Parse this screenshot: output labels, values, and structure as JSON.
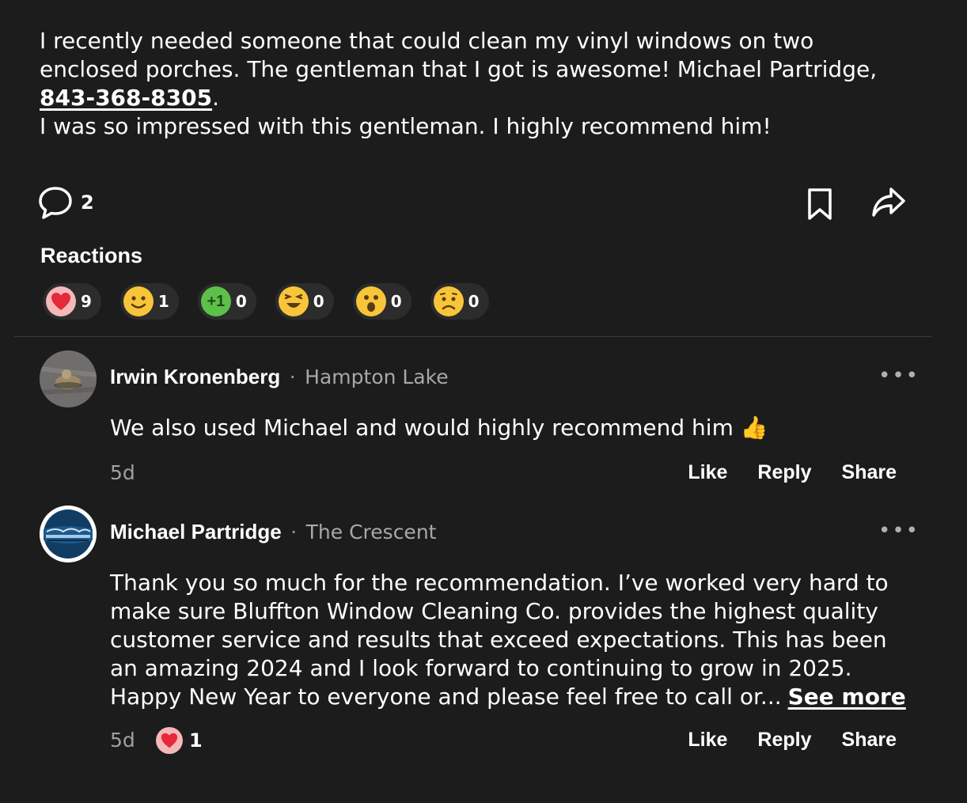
{
  "post": {
    "text_line1": "I recently needed someone that could clean my vinyl windows on two",
    "text_line2": "enclosed porches. The gentleman that I got is awesome! Michael Partridge,",
    "phone": "843-368-8305",
    "phone_suffix": ".",
    "text_line4": "I was so impressed with this gentleman. I highly recommend him!"
  },
  "actions": {
    "comment_count": "2",
    "comment_icon": "speech-bubble-icon",
    "bookmark_icon": "bookmark-icon",
    "share_icon": "share-arrow-icon"
  },
  "reactions": {
    "title": "Reactions",
    "items": [
      {
        "icon": "heart-icon",
        "emoji": "❤",
        "count": "9"
      },
      {
        "icon": "smile-icon",
        "emoji": "🙂",
        "count": "1"
      },
      {
        "icon": "plus-one-icon",
        "emoji": "+1",
        "count": "0"
      },
      {
        "icon": "laugh-icon",
        "emoji": "😆",
        "count": "0"
      },
      {
        "icon": "surprised-icon",
        "emoji": "😮",
        "count": "0"
      },
      {
        "icon": "sad-icon",
        "emoji": "😟",
        "count": "0"
      }
    ]
  },
  "comments": [
    {
      "author": "Irwin Kronenberg",
      "separator": "·",
      "location": "Hampton Lake",
      "text": "We also used Michael and would highly recommend him 👍",
      "time": "5d",
      "like": "Like",
      "reply": "Reply",
      "share": "Share"
    },
    {
      "author": "Michael Partridge",
      "separator": "·",
      "location": "The Crescent",
      "text_line1": "Thank you so much for the recommendation. I’ve worked very hard to",
      "text_line2": "make sure Bluffton Window Cleaning Co. provides the highest quality",
      "text_line3": "customer service and results that exceed expectations.  This has been",
      "text_line4": "an amazing 2024 and I look forward to continuing to grow in 2025.",
      "text_line5": "Happy New Year to everyone and please feel free to call or...",
      "see_more": "See more",
      "time": "5d",
      "reaction_count": "1",
      "like": "Like",
      "reply": "Reply",
      "share": "Share"
    }
  ],
  "more_icon": "•••"
}
